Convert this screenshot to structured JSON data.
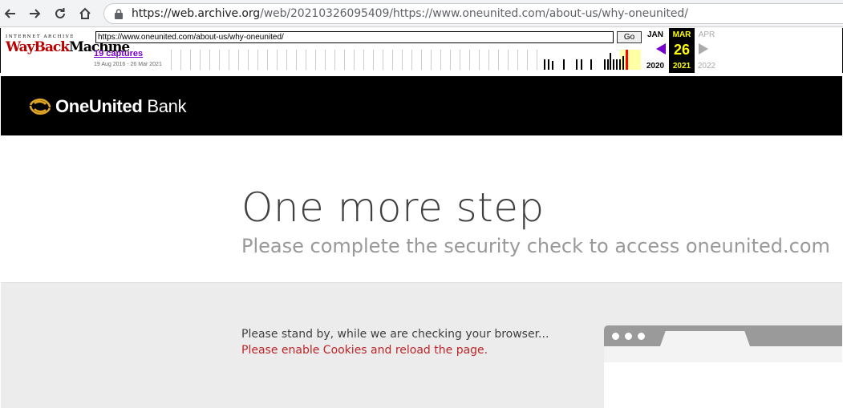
{
  "browser": {
    "url_host": "https://web.archive.org",
    "url_path": "/web/20210326095409/https://www.oneunited.com/about-us/why-oneunited/"
  },
  "wayback": {
    "logo_top": "INTERNET ARCHIVE",
    "logo_way": "WayBack",
    "logo_machine": "Machine",
    "url_input": "https://www.oneunited.com/about-us/why-oneunited/",
    "go_label": "Go",
    "captures": "19 captures",
    "date_range": "19 Aug 2016 - 26 Mar 2021",
    "prev": {
      "month": "JAN",
      "year": "2020"
    },
    "current": {
      "month": "MAR",
      "day": "26",
      "year": "2021"
    },
    "next": {
      "month": "APR",
      "year": "2022"
    }
  },
  "site": {
    "brand_bold": "OneUnited",
    "brand_light": " Bank",
    "title": "One more step",
    "subtitle": "Please complete the security check to access oneunited.com",
    "standby": "Please stand by, while we are checking your browser...",
    "cookies": "Please enable Cookies and reload the page."
  },
  "colors": {
    "header_bg": "#000000",
    "brand_gold": "#e0a526",
    "error_red": "#bd2426",
    "wayback_purple": "#7700cc"
  }
}
